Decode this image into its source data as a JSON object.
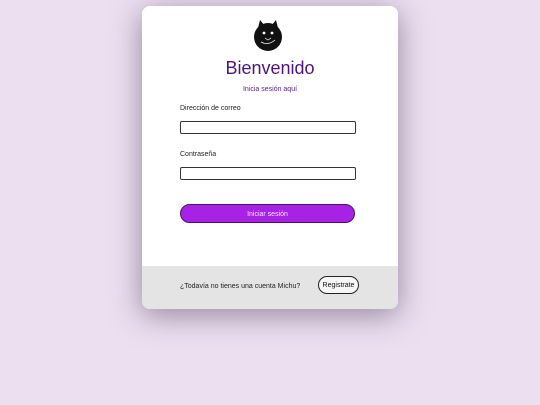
{
  "login": {
    "logo_icon": "black-cat-icon",
    "title": "Bienvenido",
    "subtitle": "Inicia sesión aquí",
    "email": {
      "label": "Dirección de correo",
      "value": ""
    },
    "password": {
      "label": "Contraseña",
      "value": ""
    },
    "submit_label": "Iniciar sesión"
  },
  "footer": {
    "prompt": "¿Todavía no tienes una cuenta Michu?",
    "register_label": "Registrate"
  },
  "colors": {
    "page_background": "#ebdff0",
    "accent": "#a822e6",
    "title": "#4e1577"
  }
}
